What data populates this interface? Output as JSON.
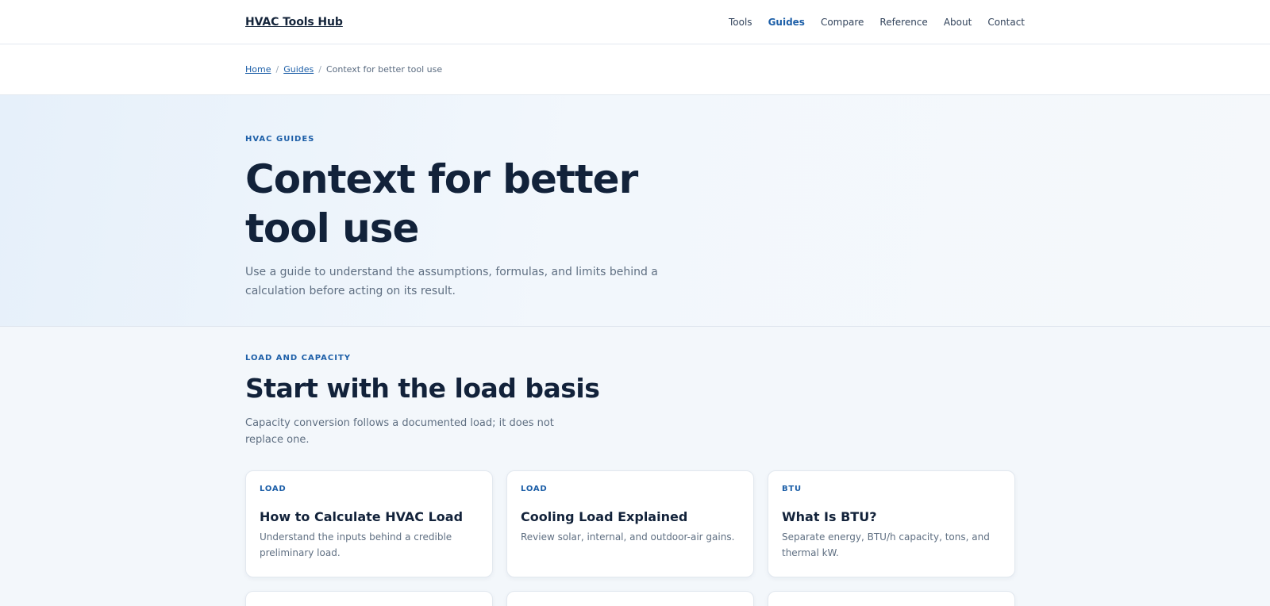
{
  "header": {
    "brand": "HVAC Tools Hub",
    "nav": [
      {
        "label": "Tools",
        "active": false
      },
      {
        "label": "Guides",
        "active": true
      },
      {
        "label": "Compare",
        "active": false
      },
      {
        "label": "Reference",
        "active": false
      },
      {
        "label": "About",
        "active": false
      },
      {
        "label": "Contact",
        "active": false
      }
    ]
  },
  "breadcrumb": {
    "home": "Home",
    "separator": "/",
    "guides": "Guides",
    "current": "Context for better tool use"
  },
  "hero": {
    "eyebrow": "HVAC GUIDES",
    "title": "Context for better tool use",
    "description": "Use a guide to understand the assumptions, formulas, and limits behind a calculation before acting on its result."
  },
  "section": {
    "eyebrow": "LOAD AND CAPACITY",
    "title": "Start with the load basis",
    "lead": "Capacity conversion follows a documented load; it does not replace one.",
    "cards": [
      {
        "tag": "LOAD",
        "title": "How to Calculate HVAC Load",
        "description": "Understand the inputs behind a credible preliminary load."
      },
      {
        "tag": "LOAD",
        "title": "Cooling Load Explained",
        "description": "Review solar, internal, and outdoor-air gains."
      },
      {
        "tag": "BTU",
        "title": "What Is BTU?",
        "description": "Separate energy, BTU/h capacity, tons, and thermal kW."
      }
    ]
  },
  "colors": {
    "accent": "#1d5fa8",
    "heading": "#12223a",
    "muted": "#5f6f82",
    "page_bg": "#f3f7fb"
  }
}
